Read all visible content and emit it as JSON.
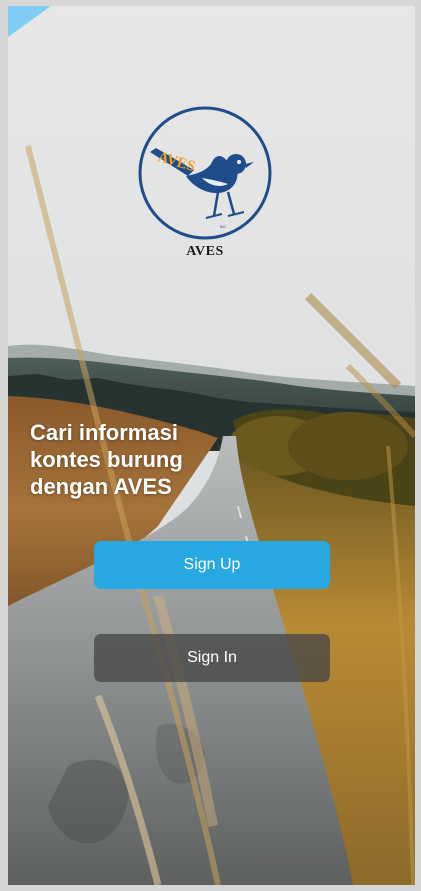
{
  "brand": {
    "logo_text": "AVES",
    "logo_initials": "AVES",
    "name": "AVES"
  },
  "hero": {
    "line1": "Cari informasi",
    "line2": "kontes burung",
    "line3": "dengan AVES"
  },
  "actions": {
    "signup_label": "Sign Up",
    "signin_label": "Sign In"
  },
  "colors": {
    "ribbon": "#7fcdf4",
    "logo_blue": "#1f4d8c",
    "logo_orange": "#f0a020",
    "signup_button": "#27a8e0",
    "signin_button": "#464646"
  },
  "icons": {
    "logo": "bird-logo-icon"
  }
}
